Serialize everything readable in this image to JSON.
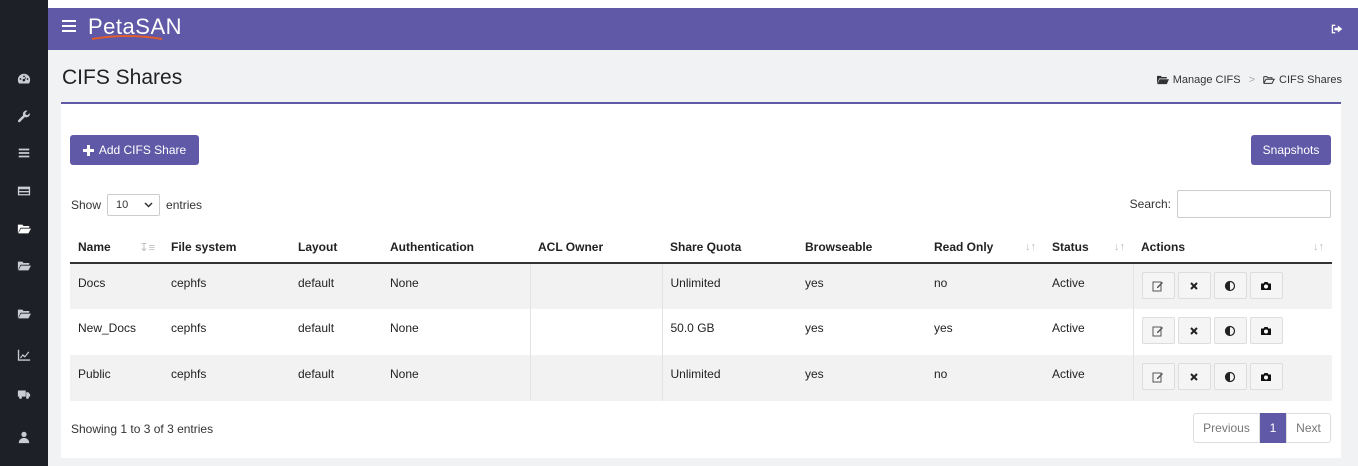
{
  "app": {
    "logo_prefix": "Peta",
    "logo_suffix": "SAN"
  },
  "sidebar": {
    "icons": [
      "dashboard-icon",
      "wrench-icon",
      "list-icon",
      "table-icon",
      "folder-icon",
      "folder-icon",
      "folder-icon",
      "chart-icon",
      "truck-icon",
      "user-icon"
    ],
    "active_index": 4
  },
  "page": {
    "title": "CIFS Shares"
  },
  "breadcrumb": {
    "item1": "Manage CIFS",
    "item2": "CIFS Shares"
  },
  "toolbar": {
    "add_label": "Add CIFS Share",
    "snapshots_label": "Snapshots"
  },
  "table_controls": {
    "show_label": "Show",
    "entries_value": "10",
    "entries_label": "entries",
    "search_label": "Search:"
  },
  "table": {
    "headers": [
      "Name",
      "File system",
      "Layout",
      "Authentication",
      "ACL Owner",
      "Share Quota",
      "Browseable",
      "Read Only",
      "Status",
      "Actions"
    ],
    "rows": [
      {
        "name": "Docs",
        "fs": "cephfs",
        "layout": "default",
        "auth": "None",
        "acl": "",
        "quota": "Unlimited",
        "browse": "yes",
        "ro": "no",
        "status": "Active"
      },
      {
        "name": "New_Docs",
        "fs": "cephfs",
        "layout": "default",
        "auth": "None",
        "acl": "",
        "quota": "50.0 GB",
        "browse": "yes",
        "ro": "yes",
        "status": "Active"
      },
      {
        "name": "Public",
        "fs": "cephfs",
        "layout": "default",
        "auth": "None",
        "acl": "",
        "quota": "Unlimited",
        "browse": "yes",
        "ro": "no",
        "status": "Active"
      }
    ]
  },
  "footer": {
    "showing": "Showing 1 to 3 of 3 entries",
    "prev": "Previous",
    "page": "1",
    "next": "Next"
  },
  "colors": {
    "accent": "#6059a7",
    "sidebar": "#1d2127"
  }
}
